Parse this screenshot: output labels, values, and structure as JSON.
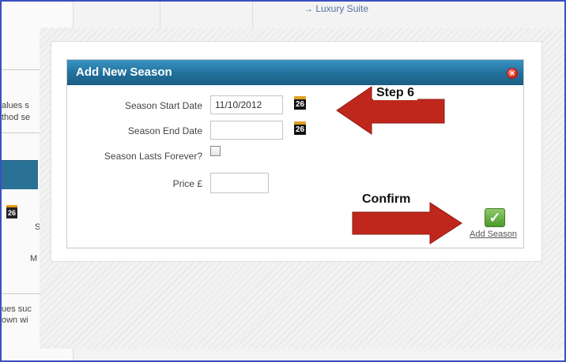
{
  "background": {
    "link_text": "→ Luxury Suite",
    "text_line1": "alues s",
    "text_line2": "thod se",
    "text_s": "S",
    "text_m": "M",
    "text_line3": "ues suc",
    "text_line4": "own wi",
    "calendar_day": "26"
  },
  "dialog": {
    "title": "Add New Season",
    "close_symbol": "✕",
    "fields": {
      "start_label": "Season Start Date",
      "start_value": "11/10/2012",
      "end_label": "Season End Date",
      "end_value": "",
      "forever_label": "Season Lasts Forever?",
      "forever_checked": false,
      "price_label": "Price £",
      "price_value": ""
    },
    "calendar_day": "26",
    "add_icon_symbol": "✓",
    "add_label": "Add Season"
  },
  "annotations": {
    "step_label": "Step 6",
    "confirm_label": "Confirm"
  },
  "colors": {
    "header_blue": "#216f9a",
    "arrow_red": "#c0271c",
    "frame_blue": "#3b4fc0"
  }
}
